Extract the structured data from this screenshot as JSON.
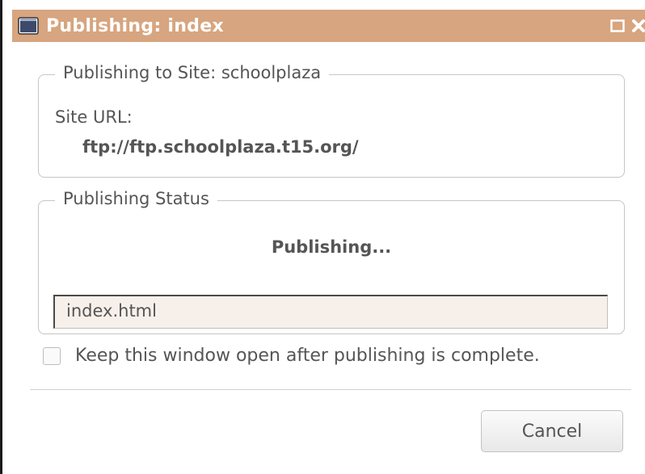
{
  "window": {
    "title": "Publishing: index",
    "titlebar_color": "#d7a57f",
    "icon": "app-window-icon",
    "controls": [
      "maximize-icon",
      "close-icon"
    ]
  },
  "site_group": {
    "legend": "Publishing to Site: schoolplaza",
    "site_url_label": "Site URL:",
    "site_url_value": "ftp://ftp.schoolplaza.t15.org/"
  },
  "status_group": {
    "legend": "Publishing Status",
    "status_text": "Publishing...",
    "progress_file": "index.html",
    "progress_fraction": 1.0
  },
  "options": {
    "keep_open_label": "Keep this window open after publishing is complete.",
    "keep_open_checked": false
  },
  "buttons": {
    "cancel_label": "Cancel"
  }
}
